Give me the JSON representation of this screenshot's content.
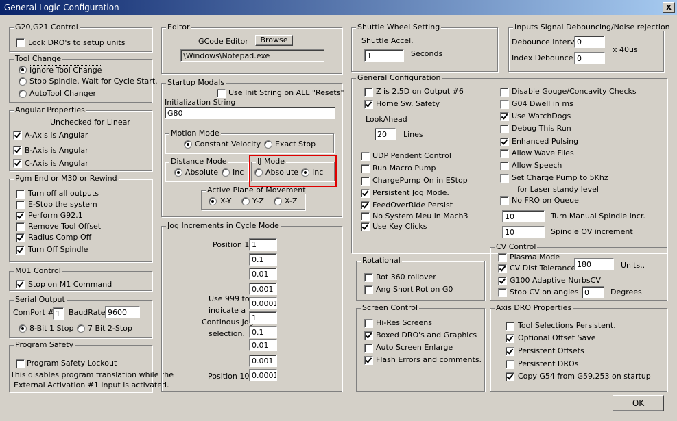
{
  "window": {
    "title": "General Logic Configuration",
    "close_glyph": "x"
  },
  "g20": {
    "legend": "G20,G21 Control",
    "lock": "Lock DRO's to setup units"
  },
  "tool_change": {
    "legend": "Tool Change",
    "opt1": "Ignore Tool Change",
    "opt2": "Stop Spindle. Wait for Cycle Start.",
    "opt3": "AutoTool Changer"
  },
  "angular": {
    "legend": "Angular Properties",
    "note": "Unchecked for Linear",
    "a": "A-Axis is Angular",
    "b": "B-Axis is Angular",
    "c": "C-Axis is Angular"
  },
  "pgm_end": {
    "legend": "Pgm End or M30 or Rewind",
    "i1": "Turn off all outputs",
    "i2": "E-Stop the system",
    "i3": "Perform G92.1",
    "i4": "Remove Tool Offset",
    "i5": "Radius Comp Off",
    "i6": "Turn Off Spindle"
  },
  "m01": {
    "legend": "M01 Control",
    "stop": "Stop on M1 Command"
  },
  "serial": {
    "legend": "Serial Output",
    "comport_label": "ComPort #",
    "comport": "1",
    "baud_label": "BaudRate",
    "baud": "9600",
    "bit8": "8-Bit 1 Stop",
    "bit7": "7 Bit 2-Stop"
  },
  "prog_safety": {
    "legend": "Program Safety",
    "lockout": "Program Safety Lockout",
    "note1": "This disables program translation while the",
    "note2": "External Activation #1 input is activated."
  },
  "editor": {
    "legend": "Editor",
    "label": "GCode Editor",
    "browse": "Browse",
    "path": "\\Windows\\Notepad.exe"
  },
  "startup": {
    "legend": "Startup Modals",
    "use_init": "Use Init String on ALL  \"Resets\"",
    "init_label": "Initialization String",
    "init_value": "G80",
    "motion_legend": "Motion Mode",
    "const_vel": "Constant Velocity",
    "exact_stop": "Exact Stop",
    "dist_legend": "Distance Mode",
    "absolute": "Absolute",
    "inc": "Inc",
    "ij_legend": "IJ Mode",
    "ij_absolute": "Absolute",
    "ij_inc": "Inc",
    "plane_legend": "Active Plane of Movement",
    "xy": "X-Y",
    "yz": "Y-Z",
    "xz": "X-Z"
  },
  "jog": {
    "legend": "Jog Increments in Cycle Mode",
    "pos1": "Position 1",
    "pos10": "Position 10",
    "note": [
      "Use 999 to",
      "indicate a",
      "Continous Jog",
      "selection."
    ],
    "values": [
      "1",
      "0.1",
      "0.01",
      "0.001",
      "0.0001",
      "1",
      "0.1",
      "0.01",
      "0.001",
      "0.0001"
    ]
  },
  "shuttle": {
    "legend": "Shuttle Wheel Setting",
    "label": "Shuttle Accel.",
    "value": "1",
    "unit": "Seconds"
  },
  "debounce": {
    "legend": "Inputs Signal Debouncing/Noise rejection",
    "interval_label": "Debounce Interval",
    "interval": "0",
    "index_label": "Index Debounce",
    "index": "0",
    "unit": "x 40us"
  },
  "general": {
    "legend": "General Configuration",
    "z25d": "Z is 2.5D on Output #6",
    "home_safety": "Home Sw. Safety",
    "lookahead_label": "LookAhead",
    "lookahead": "20",
    "lines": "Lines",
    "udp": "UDP Pendent Control",
    "run_macro": "Run Macro Pump",
    "charge_estop": "ChargePump On in EStop",
    "persistent_jog": "Persistent Jog Mode.",
    "feed_override": "FeedOverRide Persist",
    "no_sys_menu": "No System Meu in Mach3",
    "use_key_clicks": "Use Key Clicks",
    "disable_gouge": "Disable Gouge/Concavity Checks",
    "g04": "G04 Dwell in ms",
    "watchdogs": "Use WatchDogs",
    "debug": "Debug This Run",
    "enhanced": "Enhanced Pulsing",
    "wave": "Allow Wave Files",
    "speech": "Allow Speech",
    "charge5k": "Set Charge Pump to 5Khz",
    "laser": "for Laser standy level",
    "no_fro": "No FRO on Queue",
    "spindle_incr": "10",
    "spindle_incr_label": "Turn Manual Spindle Incr.",
    "spindle_ov": "10",
    "spindle_ov_label": "Spindle OV increment"
  },
  "rotational": {
    "legend": "Rotational",
    "rollover": "Rot 360 rollover",
    "short": "Ang Short Rot on G0"
  },
  "screen": {
    "legend": "Screen Control",
    "hires": "Hi-Res Screens",
    "boxed": "Boxed DRO's and Graphics",
    "auto_enlarge": "Auto Screen Enlarge",
    "flash": "Flash Errors and comments."
  },
  "cv": {
    "legend": "CV Control",
    "plasma": "Plasma Mode",
    "dist_tol": "CV Dist Tolerance",
    "dist_tol_value": "180",
    "units": "Units..",
    "g100": "G100 Adaptive NurbsCV",
    "stop_cv": "Stop CV on angles >",
    "stop_cv_value": "0",
    "degrees": "Degrees"
  },
  "axis_dro": {
    "legend": "Axis DRO Properties",
    "tool_sel": "Tool Selections Persistent.",
    "opt_offset": "Optional Offset Save",
    "persist_offsets": "Persistent Offsets",
    "persist_dros": "Persistent DROs",
    "copy_g54": "Copy G54 from G59.253 on startup"
  },
  "ok": "OK"
}
